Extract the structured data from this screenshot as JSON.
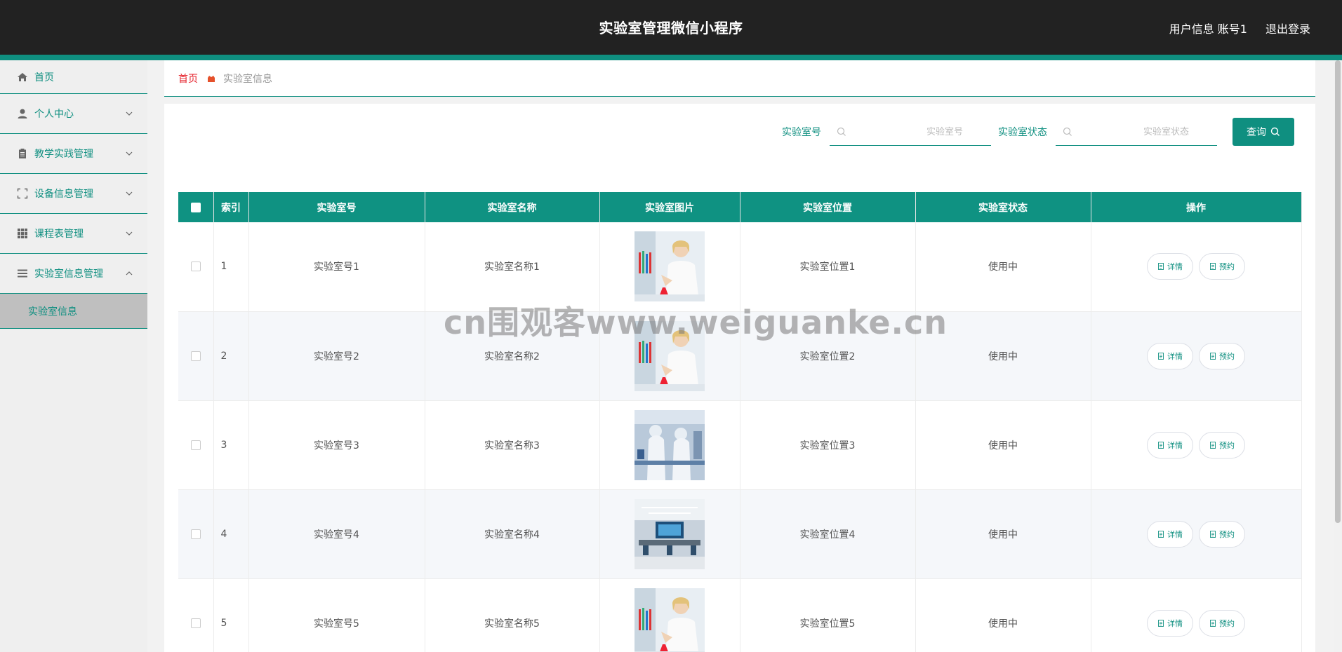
{
  "header": {
    "title": "实验室管理微信小程序",
    "user_info": "用户信息 账号1",
    "logout": "退出登录"
  },
  "sidebar": {
    "items": [
      {
        "label": "首页",
        "icon": "home-icon"
      },
      {
        "label": "个人中心",
        "icon": "user-icon"
      },
      {
        "label": "教学实践管理",
        "icon": "clipboard-icon"
      },
      {
        "label": "设备信息管理",
        "icon": "frame-icon"
      },
      {
        "label": "课程表管理",
        "icon": "grid-icon"
      },
      {
        "label": "实验室信息管理",
        "icon": "menu-icon"
      }
    ],
    "sub_item": "实验室信息"
  },
  "breadcrumb": {
    "home": "首页",
    "current": "实验室信息"
  },
  "search": {
    "lab_no_label": "实验室号",
    "lab_no_placeholder": "实验室号",
    "lab_status_label": "实验室状态",
    "lab_status_placeholder": "实验室状态",
    "query_label": "查询"
  },
  "table": {
    "headers": [
      "索引",
      "实验室号",
      "实验室名称",
      "实验室图片",
      "实验室位置",
      "实验室状态",
      "操作"
    ],
    "rows": [
      {
        "index": "1",
        "lab_no": "实验室号1",
        "name": "实验室名称1",
        "location": "实验室位置1",
        "status": "使用中"
      },
      {
        "index": "2",
        "lab_no": "实验室号2",
        "name": "实验室名称2",
        "location": "实验室位置2",
        "status": "使用中"
      },
      {
        "index": "3",
        "lab_no": "实验室号3",
        "name": "实验室名称3",
        "location": "实验室位置3",
        "status": "使用中"
      },
      {
        "index": "4",
        "lab_no": "实验室号4",
        "name": "实验室名称4",
        "location": "实验室位置4",
        "status": "使用中"
      },
      {
        "index": "5",
        "lab_no": "实验室号5",
        "name": "实验室名称5",
        "location": "实验室位置5",
        "status": "使用中"
      }
    ],
    "detail_label": "详情",
    "reserve_label": "预约"
  },
  "watermark": "cn围观客www.weiguanke.cn",
  "colors": {
    "accent": "#0f8f80",
    "header_bg": "#222222",
    "breadcrumb_home": "#e5212b"
  }
}
